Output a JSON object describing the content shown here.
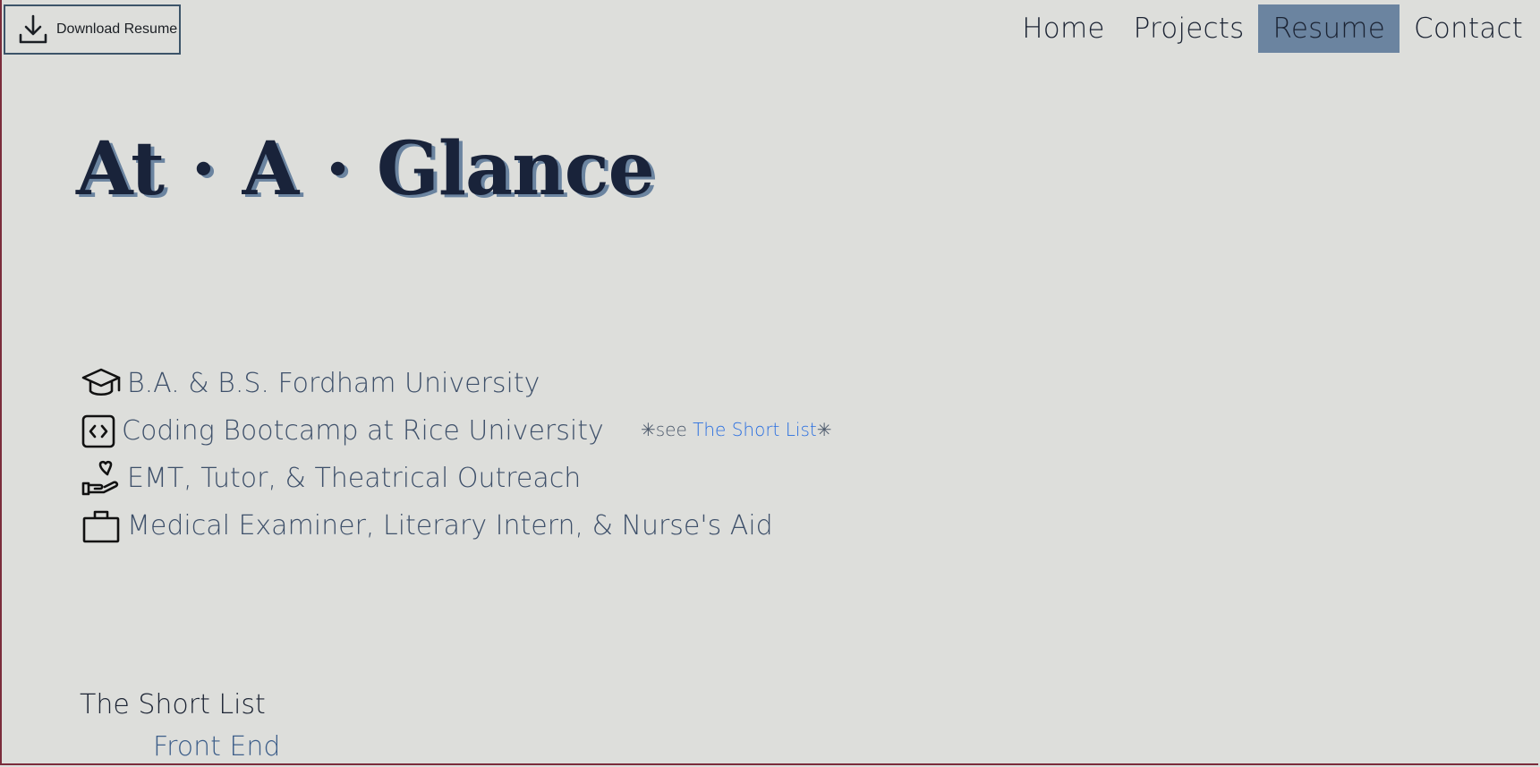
{
  "header": {
    "download_label": "Download Resume",
    "nav": [
      {
        "label": "Home"
      },
      {
        "label": "Projects"
      },
      {
        "label": "Resume",
        "active": true
      },
      {
        "label": "Contact"
      }
    ]
  },
  "hero": {
    "word1": "At",
    "sep1": "·",
    "word2": "A",
    "sep2": "·",
    "word3": "Glance"
  },
  "glance_items": [
    {
      "icon": "graduation-cap-icon",
      "text": "B.A. & B.S. Fordham University"
    },
    {
      "icon": "code-icon",
      "text": "Coding Bootcamp at Rice University"
    },
    {
      "icon": "hand-heart-icon",
      "text": "EMT, Tutor, & Theatrical Outreach"
    },
    {
      "icon": "briefcase-icon",
      "text": "Medical Examiner, Literary Intern, & Nurse's Aid"
    }
  ],
  "see_note": {
    "prefix": "✳see ",
    "link": "The Short List",
    "suffix": "✳"
  },
  "short_list": {
    "title": "The Short List",
    "first_section": "Front End"
  },
  "colors": {
    "background": "#dddedb",
    "accent": "#6b84a0",
    "title": "#19233a",
    "link": "#2a6fe0"
  }
}
